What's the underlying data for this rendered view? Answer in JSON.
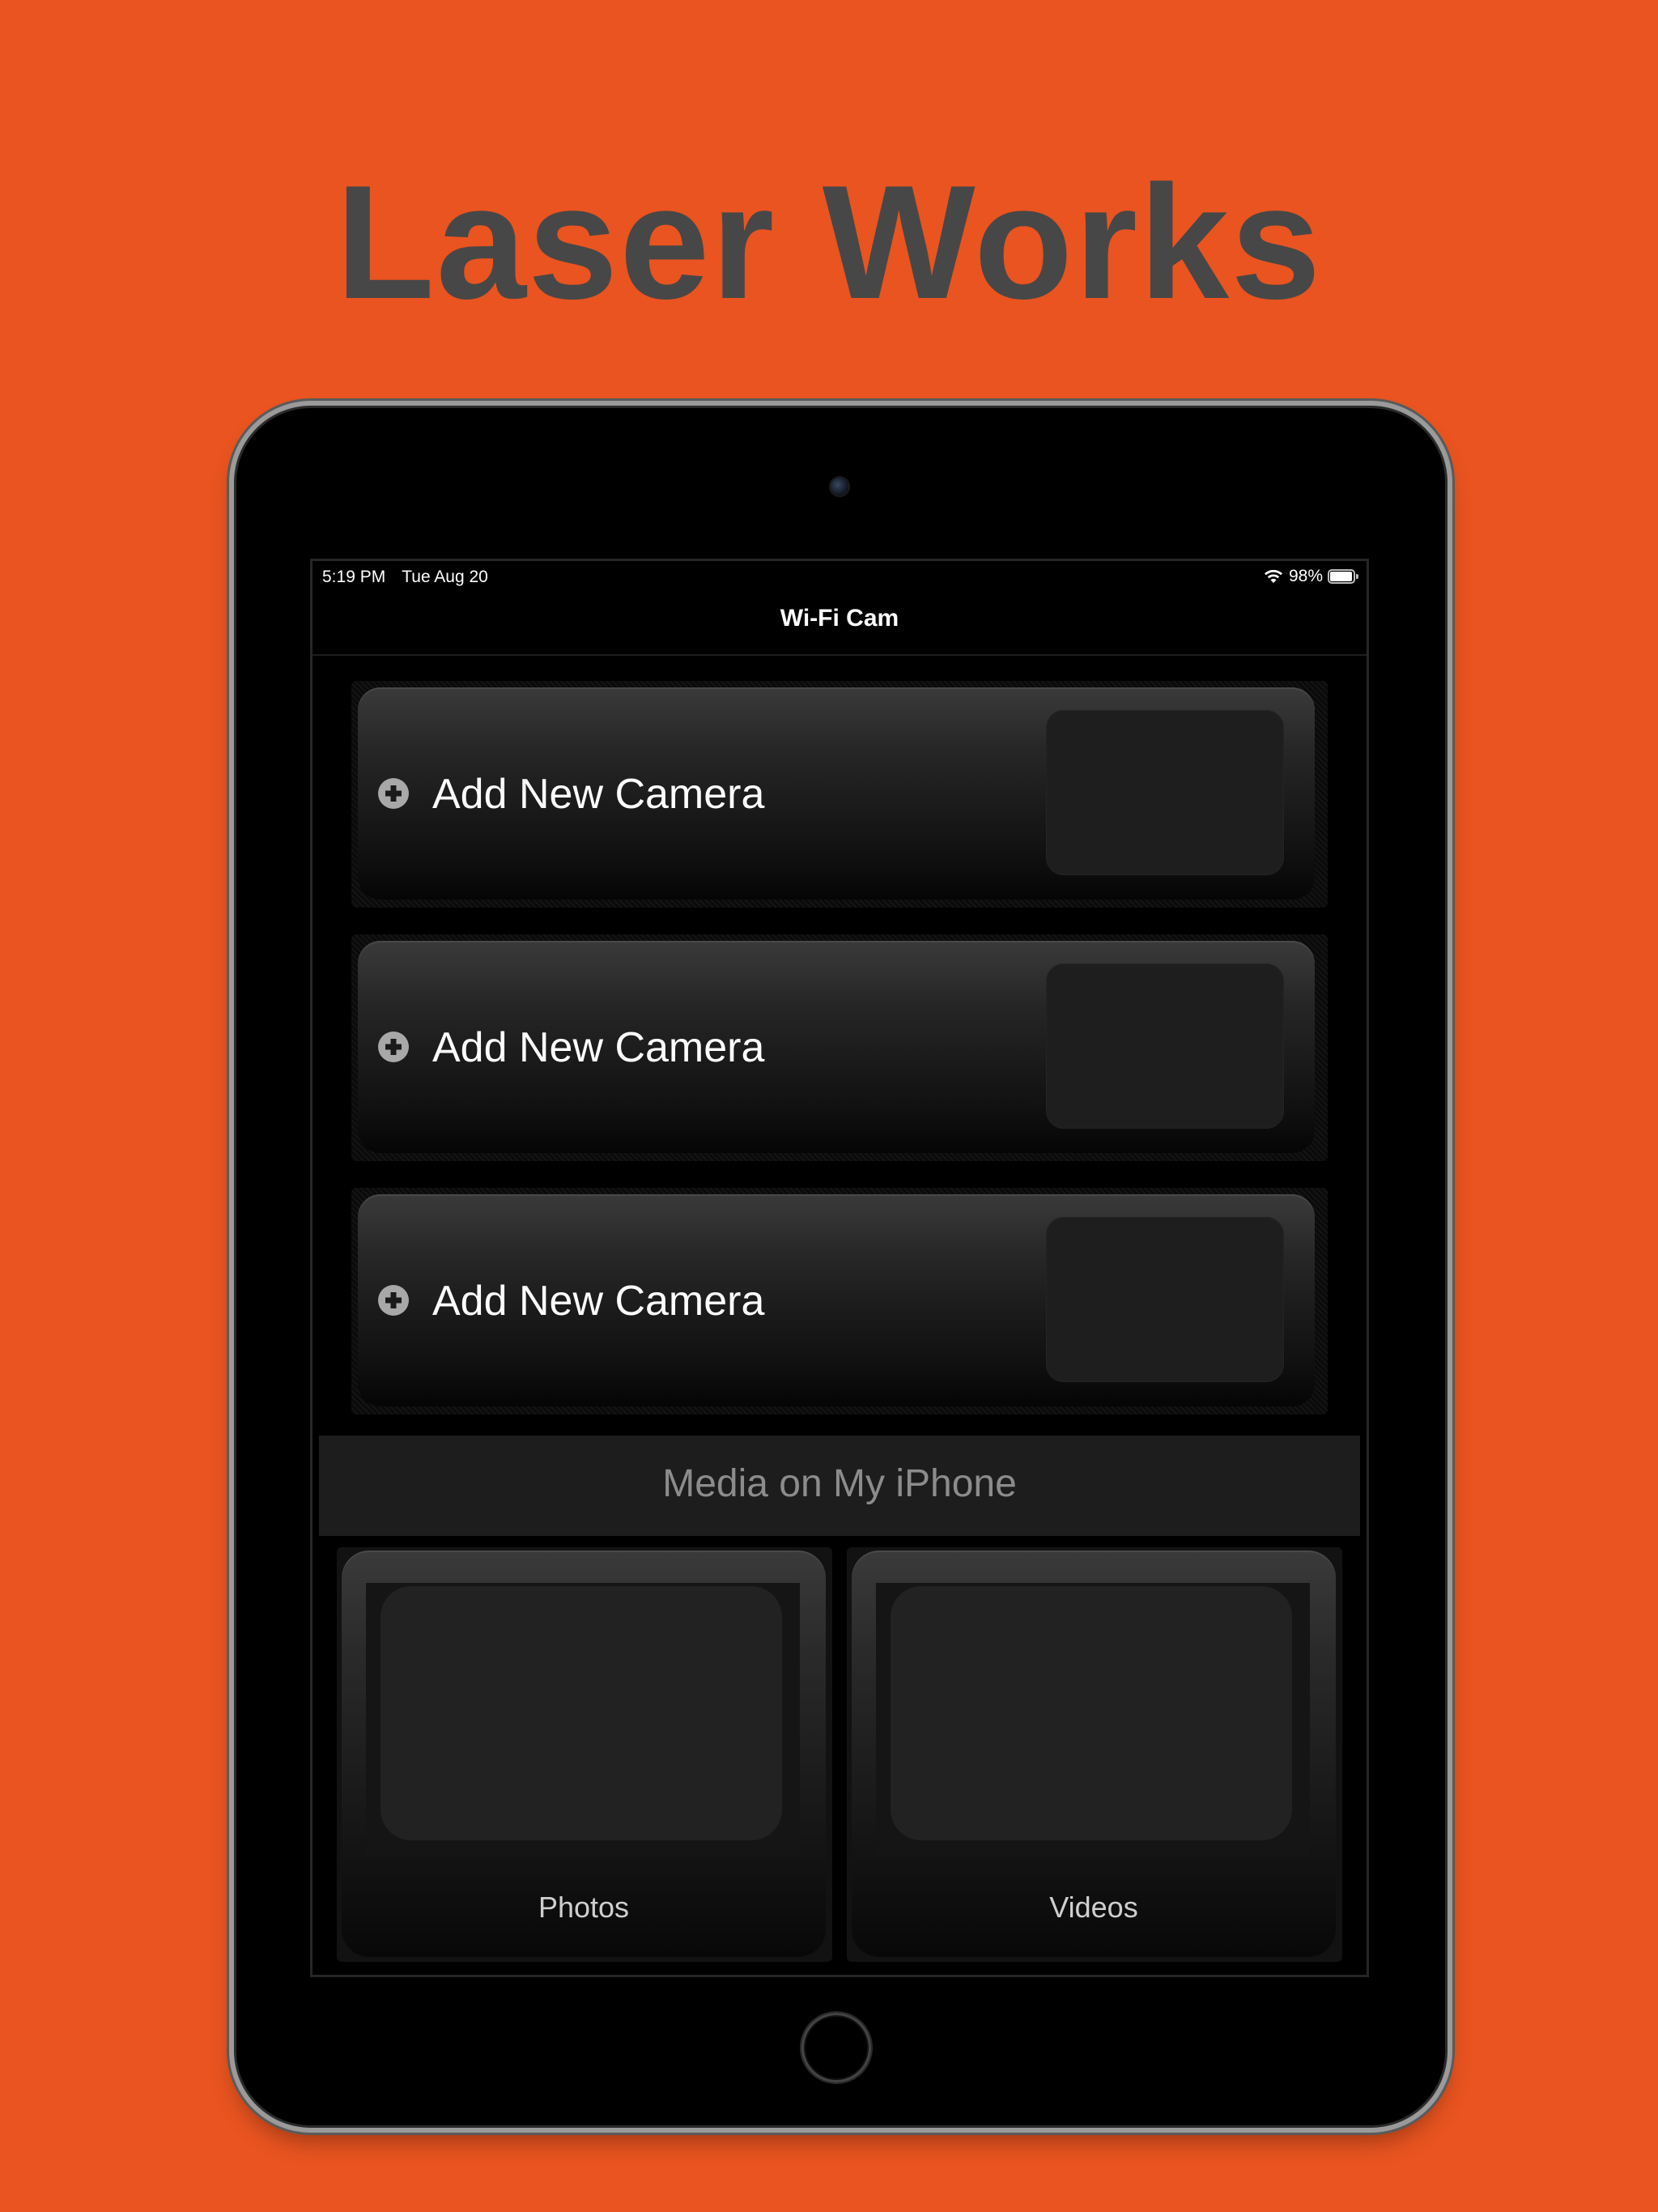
{
  "promo": {
    "title": "Laser Works",
    "background_color": "#e95420",
    "title_color": "#474747"
  },
  "status_bar": {
    "time": "5:19 PM",
    "date": "Tue Aug 20",
    "battery_percent": "98%",
    "battery_level": 0.98,
    "icons": [
      "wifi-icon",
      "battery-icon"
    ]
  },
  "nav": {
    "title": "Wi-Fi Cam"
  },
  "camera_slots": [
    {
      "label": "Add New Camera",
      "icon": "add-circle-icon"
    },
    {
      "label": "Add New Camera",
      "icon": "add-circle-icon"
    },
    {
      "label": "Add New Camera",
      "icon": "add-circle-icon"
    }
  ],
  "media_section": {
    "title": "Media on My iPhone",
    "items": [
      {
        "label": "Photos"
      },
      {
        "label": "Videos"
      }
    ]
  }
}
